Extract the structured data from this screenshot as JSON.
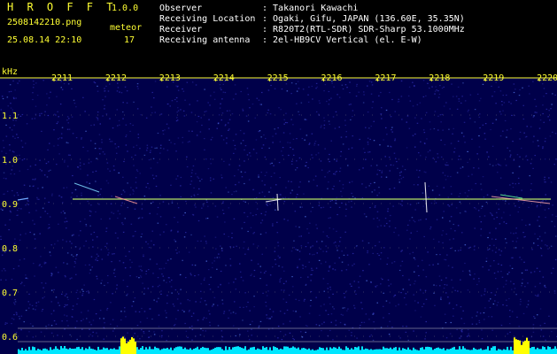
{
  "header": {
    "app_name": "H R O F F T",
    "app_version": "1.0.0",
    "filename": "2508142210.png",
    "timestamp": "25.08.14 22:10",
    "meteor_label": "meteor",
    "meteor_count": "17"
  },
  "meta": [
    {
      "key": "Observer",
      "value": ": Takanori Kawachi"
    },
    {
      "key": "Receiving Location",
      "value": ": Ogaki, Gifu, JAPAN (136.60E, 35.35N)"
    },
    {
      "key": "Receiver",
      "value": ": R820T2(RTL-SDR) SDR-Sharp 53.1000MHz"
    },
    {
      "key": "Receiving antenna",
      "value": ": 2el-HB9CV Vertical (el. E-W)"
    }
  ],
  "spectrogram": {
    "y_unit": "kHz",
    "y_ticks": [
      "1.1",
      "1.0",
      "0.9",
      "0.8",
      "0.7",
      "0.6"
    ],
    "x_ticks": [
      "2211",
      "2212",
      "2213",
      "2214",
      "2215",
      "2216",
      "2217",
      "2218",
      "2219",
      "2220"
    ],
    "carrier_khz": 0.91,
    "y_range_khz": [
      0.6,
      1.15
    ],
    "colors": {
      "background": "#00004a",
      "noise": "#2a2aa8",
      "carrier": "#ccff66",
      "axis": "#ffff33",
      "grid": "#9a9a9a",
      "power_fill": "#00e6ff",
      "power_peak": "#ffff00"
    }
  }
}
